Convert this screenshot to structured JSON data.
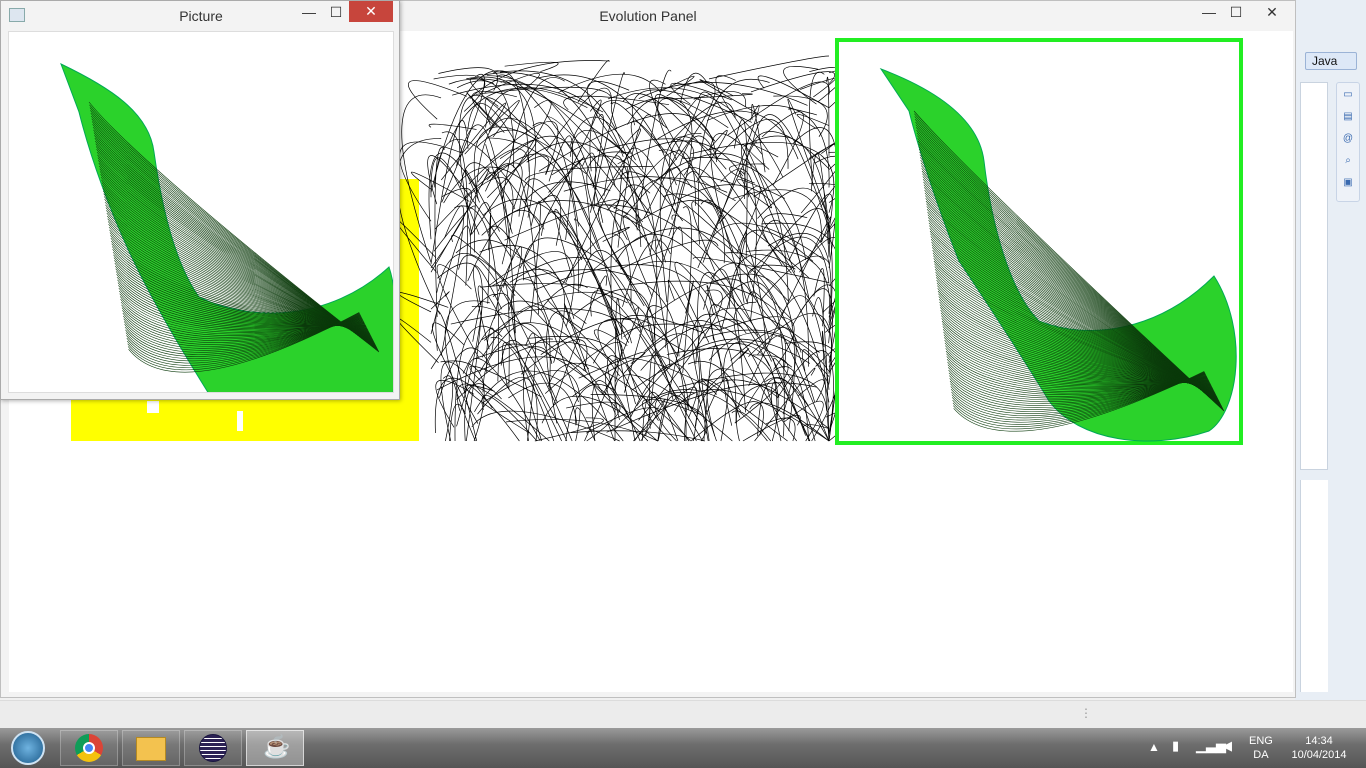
{
  "evolution_window": {
    "title": "Evolution Panel",
    "minimize": "—",
    "maximize": "☐",
    "close": "✕"
  },
  "picture_window": {
    "title": "Picture",
    "minimize": "—",
    "maximize": "☐",
    "close": "✕"
  },
  "eclipse": {
    "perspective_label": "Java"
  },
  "taskbar": {
    "apps": [
      "start-orb",
      "chrome",
      "file-explorer",
      "eclipse",
      "java"
    ],
    "language_line1": "ENG",
    "language_line2": "DA",
    "time": "14:34",
    "date": "10/04/2014"
  },
  "colors": {
    "leaf_green": "#22cc22",
    "highlight_border": "#22ee22",
    "yellow": "#ffff00",
    "orange": "#ff8000",
    "close_red": "#c7453c"
  }
}
